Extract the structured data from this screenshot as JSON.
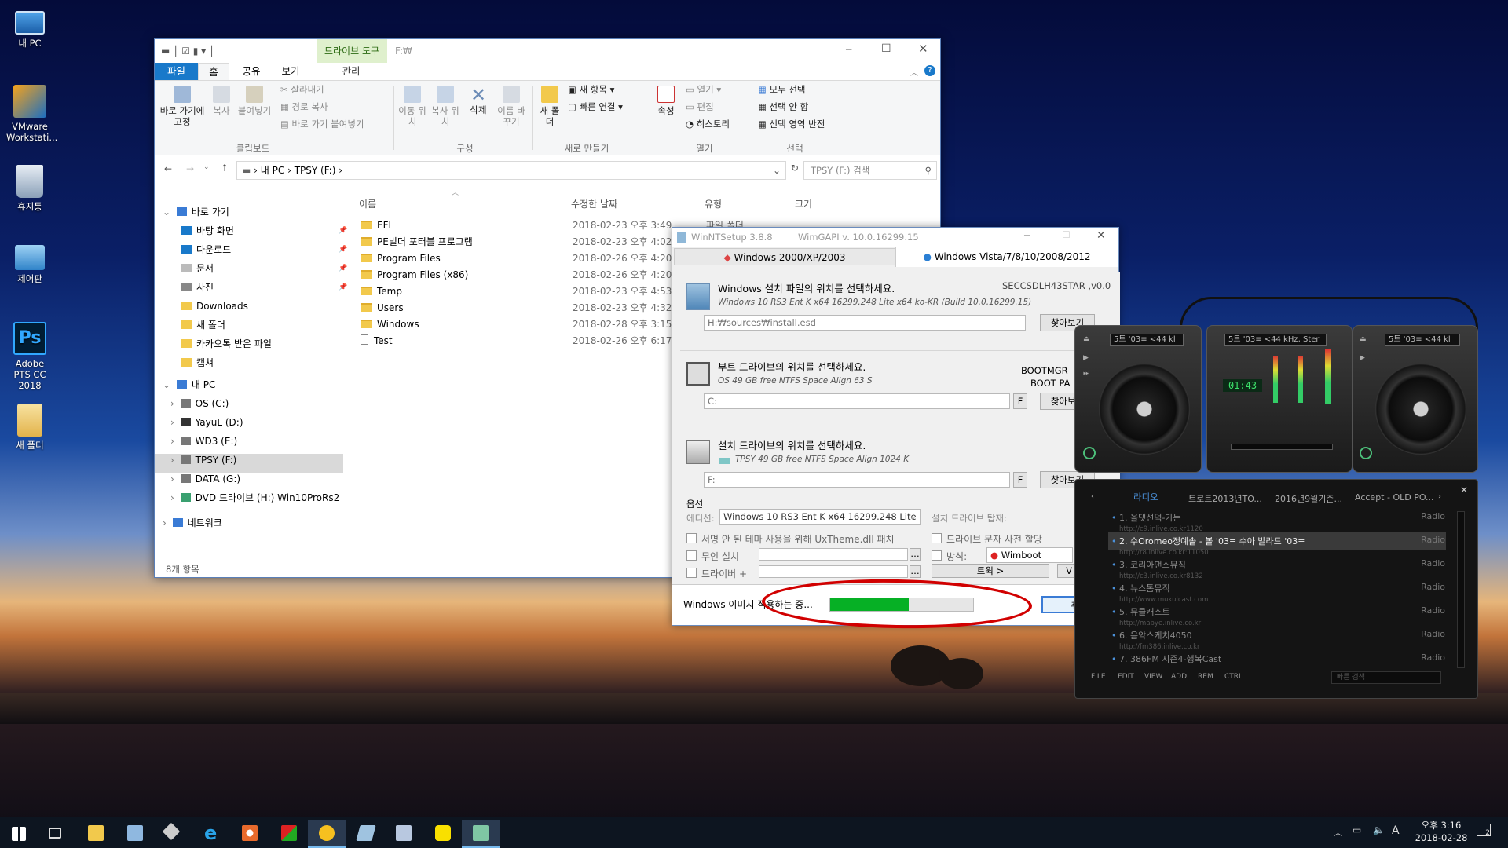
{
  "desktop": {
    "icons": [
      {
        "label": "내 PC"
      },
      {
        "label": "VMware Workstati..."
      },
      {
        "label": "휴지통"
      },
      {
        "label": "제어판"
      },
      {
        "label": "Adobe PTS CC 2018"
      },
      {
        "label": "새 폴더"
      }
    ]
  },
  "explorer": {
    "title_path": "F:₩",
    "context_tab": "드라이브 도구",
    "tabs": [
      "파일",
      "홈",
      "공유",
      "보기",
      "관리"
    ],
    "ribbon": {
      "pin": "바로 가기에 고정",
      "copy": "복사",
      "paste": "붙여넣기",
      "cut": "잘라내기",
      "copy_path": "경로 복사",
      "paste_shortcut": "바로 가기 붙여넣기",
      "move_to": "이동 위치",
      "copy_to": "복사 위치",
      "delete": "삭제",
      "rename": "이름 바꾸기",
      "new_folder": "새 폴더",
      "new_item": "새 항목",
      "easy_access": "빠른 연결",
      "properties": "속성",
      "open": "열기",
      "edit": "편집",
      "history": "히스토리",
      "select_all": "모두 선택",
      "select_none": "선택 안 함",
      "invert": "선택 영역 반전",
      "groups": [
        "클립보드",
        "구성",
        "새로 만들기",
        "열기",
        "선택"
      ]
    },
    "breadcrumb": [
      "내 PC",
      "TPSY (F:)"
    ],
    "search_placeholder": "TPSY (F:) 검색",
    "nav": [
      {
        "label": "바로 가기"
      },
      {
        "label": "바탕 화면"
      },
      {
        "label": "다운로드"
      },
      {
        "label": "문서"
      },
      {
        "label": "사진"
      },
      {
        "label": "Downloads"
      },
      {
        "label": "새 폴더"
      },
      {
        "label": "카카오톡 받은 파일"
      },
      {
        "label": "캡쳐"
      },
      {
        "label": "내 PC"
      },
      {
        "label": "OS (C:)"
      },
      {
        "label": "YayuL (D:)"
      },
      {
        "label": "WD3 (E:)"
      },
      {
        "label": "TPSY (F:)"
      },
      {
        "label": "DATA (G:)"
      },
      {
        "label": "DVD 드라이브 (H:) Win10ProRs2"
      },
      {
        "label": "네트워크"
      }
    ],
    "columns": [
      "이름",
      "수정한 날짜",
      "유형",
      "크기"
    ],
    "files": [
      {
        "name": "EFI",
        "date": "2018-02-23 오후 3:49",
        "type": "파일 폴더"
      },
      {
        "name": "PE빌더 포터블 프로그램",
        "date": "2018-02-23 오후 4:02"
      },
      {
        "name": "Program Files",
        "date": "2018-02-26 오후 4:20"
      },
      {
        "name": "Program Files (x86)",
        "date": "2018-02-26 오후 4:20"
      },
      {
        "name": "Temp",
        "date": "2018-02-23 오후 4:53"
      },
      {
        "name": "Users",
        "date": "2018-02-23 오후 4:32"
      },
      {
        "name": "Windows",
        "date": "2018-02-28 오후 3:15"
      },
      {
        "name": "Test",
        "date": "2018-02-26 오후 6:17"
      }
    ],
    "status": "8개 항목"
  },
  "setup": {
    "title": "WinNTSetup 3.8.8",
    "wimgapi": "WimGAPI v. 10.0.16299.15",
    "tab1": "Windows 2000/XP/2003",
    "tab2": "Windows Vista/7/8/10/2008/2012",
    "src_title": "Windows 설치 파일의 위치를 선택하세요.",
    "src_id": "SECCSDLH43STAR ,v0.0",
    "src_desc": "Windows 10 RS3 Ent K x64 16299.248 Lite x64 ko-KR (Build 10.0.16299.15)",
    "src_path": "H:₩sources₩install.esd",
    "browse": "찾아보기",
    "boot_title": "부트 드라이브의 위치를 선택하세요.",
    "boot_right1": "BOOTMGR",
    "boot_right2": "BOOT PA",
    "boot_desc": "OS 49 GB free NTFS Space Align 63 S",
    "boot_path": "C:",
    "f": "F",
    "inst_title": "설치 드라이브의 위치를 선택하세요.",
    "inst_desc": "TPSY 49 GB free NTFS Space Align 1024 K",
    "inst_path": "F:",
    "options": "옵션",
    "edition_label": "에디션:",
    "edition": "Windows 10 RS3 Ent K x64 16299.248 Lite",
    "mount_label": "설치 드라이브 탑재:",
    "uxtheme": "서명 안 된 테마 사용을 위해 UxTheme.dll 패치",
    "unattend": "무인 설치",
    "driver": "드라이버 +",
    "drive_letter": "드라이브 문자 사전 할당",
    "mode": "방식:",
    "wimboot": "Wimboot",
    "tweak": "트윅 >",
    "v": "V",
    "status": "Windows 이미지 적용하는 중...",
    "progress": 0.55,
    "cancel": "취소"
  },
  "player": {
    "lcd1": "5트 '03≡ <44 kl",
    "lcd2": "5트 '03≡ <44 kHz, Ster",
    "lcd3": "5트 '03≡ <44 kl",
    "time": "01:43",
    "tabs": [
      "라디오",
      "트로트2013년TO...",
      "2016년9월기준...",
      "Accept - OLD PO..."
    ],
    "items": [
      {
        "t": "1. 올댓선덕-가든",
        "u": "http://c9.inlive.co.kr1120",
        "r": "Radio"
      },
      {
        "t": "2. 수Oromeo정예솔 - 볼 '03≡ 수아 발라드 '03≡",
        "u": "http://r8.inlive.co.kr:11050",
        "r": "Radio"
      },
      {
        "t": "3. 코리아댄스뮤직",
        "u": "http://c3.inlive.co.kr8132",
        "r": "Radio"
      },
      {
        "t": "4. 뉴스톰뮤직",
        "u": "http://www.mukulcast.com",
        "r": "Radio"
      },
      {
        "t": "5. 뮤클캐스트",
        "u": "http://mabye.inlive.co.kr",
        "r": "Radio"
      },
      {
        "t": "6. 음악스케치4050",
        "u": "http://fm386.inlive.co.kr",
        "r": "Radio"
      },
      {
        "t": "7. 386FM 시즌4-행복Cast",
        "u": "",
        "r": "Radio"
      }
    ],
    "bottom": [
      "FILE",
      "EDIT",
      "VIEW",
      "ADD",
      "REM",
      "CTRL"
    ],
    "search": "빠른 검색"
  },
  "tray": {
    "time": "오후 3:16",
    "date": "2018-02-28",
    "ime": "A",
    "notif": "2"
  },
  "colors": {
    "accent": "#1979ca",
    "progress": "#06b025",
    "highlight": "#cce8ff",
    "annotation": "#d10000"
  }
}
